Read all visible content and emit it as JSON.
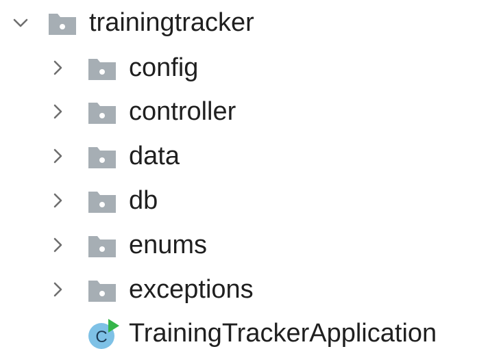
{
  "project_tree": {
    "root": {
      "label": "trainingtracker",
      "expanded": true,
      "icon": "folder-icon"
    },
    "children": [
      {
        "label": "config",
        "type": "package",
        "expanded": false,
        "icon": "folder-icon"
      },
      {
        "label": "controller",
        "type": "package",
        "expanded": false,
        "icon": "folder-icon"
      },
      {
        "label": "data",
        "type": "package",
        "expanded": false,
        "icon": "folder-icon"
      },
      {
        "label": "db",
        "type": "package",
        "expanded": false,
        "icon": "folder-icon"
      },
      {
        "label": "enums",
        "type": "package",
        "expanded": false,
        "icon": "folder-icon"
      },
      {
        "label": "exceptions",
        "type": "package",
        "expanded": false,
        "icon": "folder-icon"
      },
      {
        "label": "TrainingTrackerApplication",
        "type": "class",
        "icon": "spring-boot-class-icon",
        "icon_letter": "C"
      }
    ]
  },
  "colors": {
    "folder": "#a6aeb4",
    "folder_dot": "#ffffff",
    "chevron": "#6e6e6e",
    "class_circle": "#7ec1e6",
    "class_letter": "#1d3b55",
    "run_triangle": "#35b54a",
    "text": "#1f1f1f"
  }
}
